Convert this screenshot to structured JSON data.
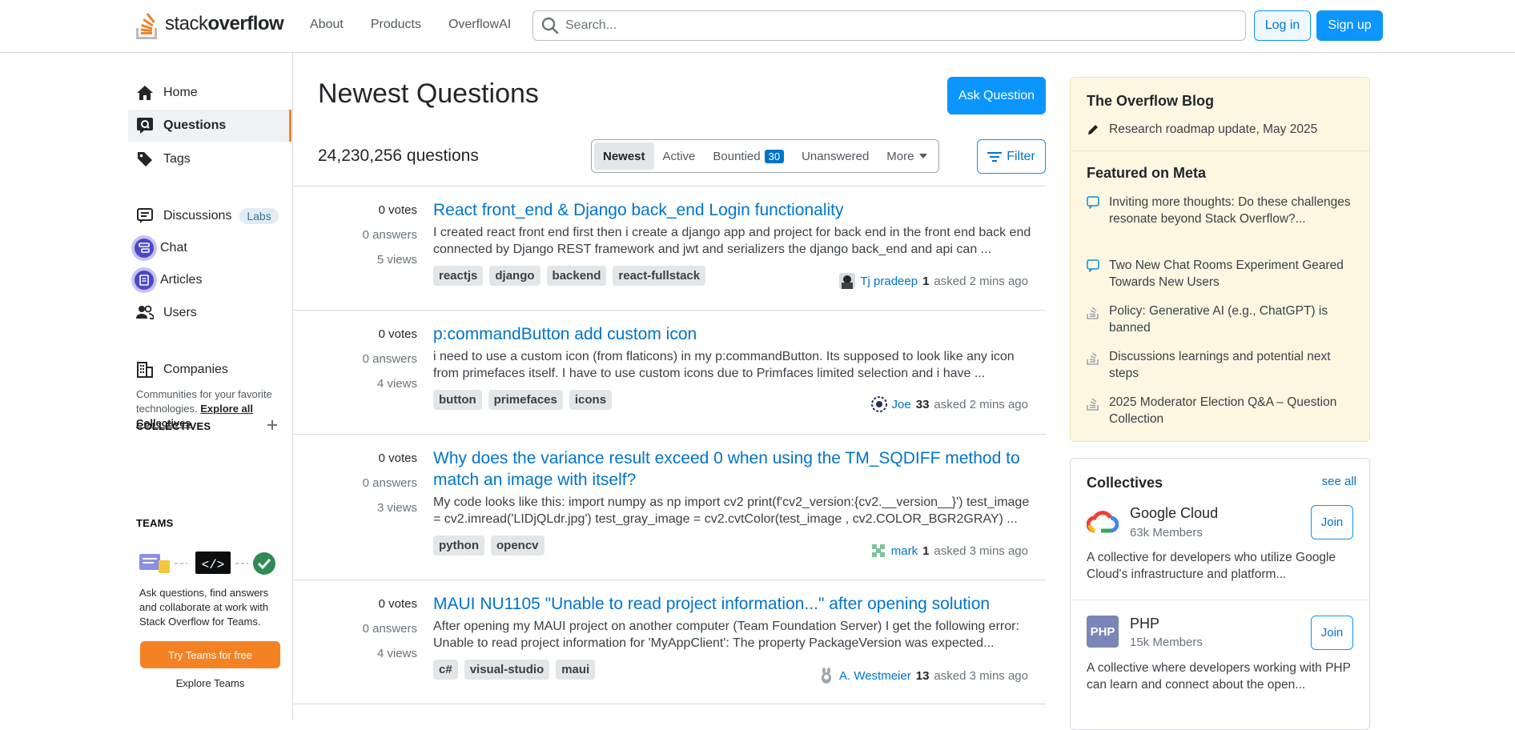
{
  "header": {
    "logo_light": "stack",
    "logo_bold": "overflow",
    "nav": [
      "About",
      "Products",
      "OverflowAI"
    ],
    "search_placeholder": "Search...",
    "login": "Log in",
    "signup": "Sign up"
  },
  "sidebar": {
    "items": [
      {
        "label": "Home",
        "icon": "home-icon"
      },
      {
        "label": "Questions",
        "icon": "questions-icon",
        "active": true
      },
      {
        "label": "Tags",
        "icon": "tag-icon"
      },
      {
        "label": "Discussions",
        "icon": "discussions-icon",
        "badge": "Labs"
      },
      {
        "label": "Chat",
        "icon": "chat-icon"
      },
      {
        "label": "Articles",
        "icon": "articles-icon"
      },
      {
        "label": "Users",
        "icon": "users-icon"
      },
      {
        "label": "Companies",
        "icon": "companies-icon"
      }
    ],
    "collectives_title": "COLLECTIVES",
    "collectives_text": "Communities for your favorite technologies.",
    "collectives_link": "Explore all Collectives",
    "teams_title": "TEAMS",
    "teams_text": "Ask questions, find answers and collaborate at work with Stack Overflow for Teams.",
    "teams_button": "Try Teams for free",
    "teams_link": "Explore Teams"
  },
  "main": {
    "title": "Newest Questions",
    "ask_button": "Ask Question",
    "count": "24,230,256 questions",
    "tabs": [
      {
        "label": "Newest",
        "active": true
      },
      {
        "label": "Active"
      },
      {
        "label": "Bountied",
        "count": "30"
      },
      {
        "label": "Unanswered"
      },
      {
        "label": "More"
      }
    ],
    "filter": "Filter",
    "questions": [
      {
        "votes": "0 votes",
        "answers": "0 answers",
        "views": "5 views",
        "title": "React front_end & Django back_end Login functionality",
        "excerpt": "I created react front end first then i create a django app and project for back end in the front end back end connected by Django REST framework and jwt and serializers the django back_end and api can ...",
        "tags": [
          "reactjs",
          "django",
          "backend",
          "react-fullstack"
        ],
        "user": "Tj pradeep",
        "rep": "1",
        "time": "asked 2 mins ago"
      },
      {
        "votes": "0 votes",
        "answers": "0 answers",
        "views": "4 views",
        "title": "p:commandButton add custom icon",
        "excerpt": "i need to use a custom icon (from flaticons) in my p:commandButton. Its supposed to look like any icon from primefaces itself. I have to use custom icons due to Primfaces limited selection and i have ...",
        "tags": [
          "button",
          "primefaces",
          "icons"
        ],
        "user": "Joe",
        "rep": "33",
        "time": "asked 2 mins ago"
      },
      {
        "votes": "0 votes",
        "answers": "0 answers",
        "views": "3 views",
        "title": "Why does the variance result exceed 0 when using the TM_SQDIFF method to match an image with itself?",
        "excerpt": "My code looks like this: import numpy as np import cv2 print(f'cv2_version:{cv2.__version__}') test_image = cv2.imread('LIDjQLdr.jpg') test_gray_image = cv2.cvtColor(test_image , cv2.COLOR_BGR2GRAY) ...",
        "tags": [
          "python",
          "opencv"
        ],
        "user": "mark",
        "rep": "1",
        "time": "asked 3 mins ago"
      },
      {
        "votes": "0 votes",
        "answers": "0 answers",
        "views": "4 views",
        "title": "MAUI NU1105 \"Unable to read project information...\" after opening solution",
        "excerpt": "After opening my MAUI project on another computer (Team Foundation Server) I get the following er­ror: Unable to read project information for 'MyAppClient': The property PackageVersion was expected...",
        "tags": [
          "c#",
          "visual-studio",
          "maui"
        ],
        "user": "A. Westmeier",
        "rep": "13",
        "time": "asked 3 mins ago"
      }
    ]
  },
  "right": {
    "blog_title": "The Overflow Blog",
    "blog_items": [
      "Research roadmap update, May 2025"
    ],
    "meta_title": "Featured on Meta",
    "meta_items": [
      "Inviting more thoughts: Do these challenges resonate beyond Stack Overflow?...",
      "Two New Chat Rooms Experiment Geared Towards New Users",
      "Policy: Generative AI (e.g., ChatGPT) is banned",
      "Discussions learnings and potential next steps",
      "2025 Moderator Election Q&A – Question Collection"
    ],
    "collectives_title": "Collectives",
    "see_all": "see all",
    "collectives": [
      {
        "name": "Google Cloud",
        "members": "63k Members",
        "join": "Join",
        "desc": "A collective for developers who utilize Google Cloud's infrastructure and platform..."
      },
      {
        "name": "PHP",
        "logo_text": "PHP",
        "members": "15k Members",
        "join": "Join",
        "desc": "A collective where developers working with PHP can learn and connect about the open..."
      }
    ]
  },
  "colors": {
    "accent": "#0a95ff",
    "link": "#0074cc",
    "orange": "#f48225",
    "blog_bg": "#fdf7e2"
  }
}
